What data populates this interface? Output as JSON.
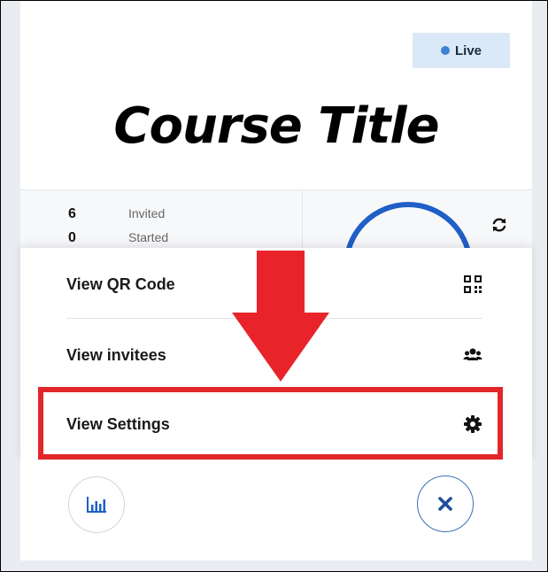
{
  "header": {
    "status_badge": "Live",
    "course_title": "Course Title"
  },
  "stats": {
    "rows": [
      {
        "value": "6",
        "label": "Invited"
      },
      {
        "value": "0",
        "label": "Started"
      }
    ]
  },
  "menu": {
    "items": [
      {
        "label": "View QR Code",
        "icon": "qr-code-icon"
      },
      {
        "label": "View invitees",
        "icon": "users-icon"
      },
      {
        "label": "View Settings",
        "icon": "gear-icon"
      }
    ]
  },
  "colors": {
    "accent": "#1f5fc6",
    "highlight": "#e3262a",
    "badge_bg": "#dbe8f7",
    "live_dot": "#3d82d6"
  },
  "icons": {
    "refresh": "refresh-icon",
    "chart_button": "bar-chart-icon",
    "close_button": "close-icon",
    "annotation": "down-arrow-icon"
  }
}
